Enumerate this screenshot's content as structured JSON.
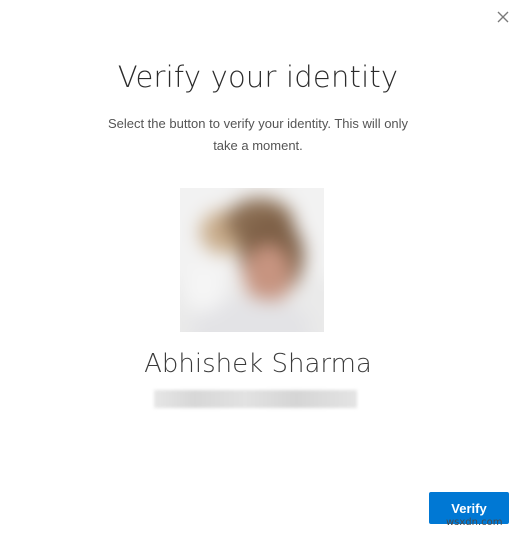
{
  "dialog": {
    "title": "Verify your identity",
    "description": "Select the button to verify your identity. This will only take a moment.",
    "close_icon": "close-icon",
    "user": {
      "name": "Abhishek Sharma",
      "avatar": "profile-photo"
    },
    "verify_button_label": "Verify"
  },
  "watermark": "wsxdn.com",
  "colors": {
    "accent": "#0078d4",
    "title_text": "#2b2b2b",
    "body_text": "#555555"
  }
}
